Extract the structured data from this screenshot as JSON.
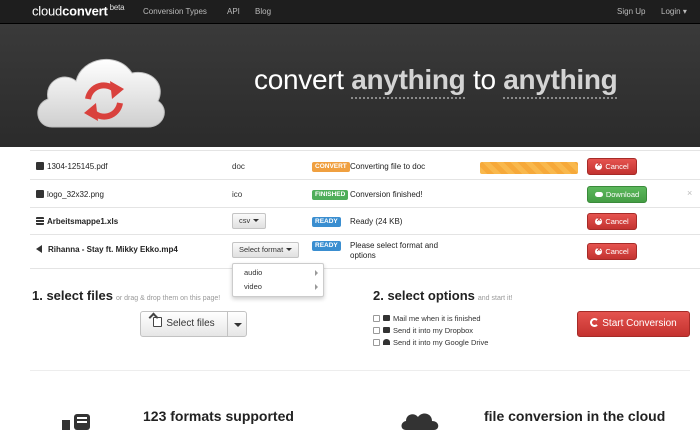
{
  "navbar": {
    "brand_light": "cloud",
    "brand_bold": "convert",
    "brand_beta": "beta",
    "links": [
      "Conversion Types",
      "API",
      "Blog"
    ],
    "signup": "Sign Up",
    "login": "Login"
  },
  "hero": {
    "word1": "convert",
    "word2": "anything",
    "word3": "to",
    "word4": "anything"
  },
  "files": [
    {
      "name": "1304-125145.pdf",
      "format": "doc",
      "badge": "CONVERT",
      "status": "Converting file to doc",
      "action": "Cancel",
      "progress": 1.0
    },
    {
      "name": "logo_32x32.png",
      "format": "ico",
      "badge": "FINISHED",
      "status": "Conversion finished!",
      "action": "Download",
      "dismiss": "×"
    },
    {
      "name": "Arbeitsmappe1.xls",
      "format": "csv",
      "badge": "READY",
      "status": "Ready (24 KB)",
      "action": "Cancel"
    },
    {
      "name": "Rihanna - Stay ft. Mikky Ekko.mp4",
      "format": "Select format",
      "badge": "READY",
      "status": "Please select format and options",
      "action": "Cancel"
    }
  ],
  "dropdown": {
    "items": [
      "audio",
      "video"
    ]
  },
  "step1": {
    "title": "1. select files",
    "sub": "or drag & drop them on this page!",
    "button": "Select files"
  },
  "step2": {
    "title": "2. select options",
    "sub": "and start it!",
    "options": [
      "Mail me when it is finished",
      "Send it into my Dropbox",
      "Send it into my Google Drive"
    ],
    "start": "Start Conversion"
  },
  "features": [
    "123 formats supported",
    "file conversion in the cloud"
  ],
  "colors": {
    "accent_red": "#d9413d",
    "green": "#4fae5a",
    "blue": "#3a8ed0",
    "orange": "#f0a040"
  }
}
